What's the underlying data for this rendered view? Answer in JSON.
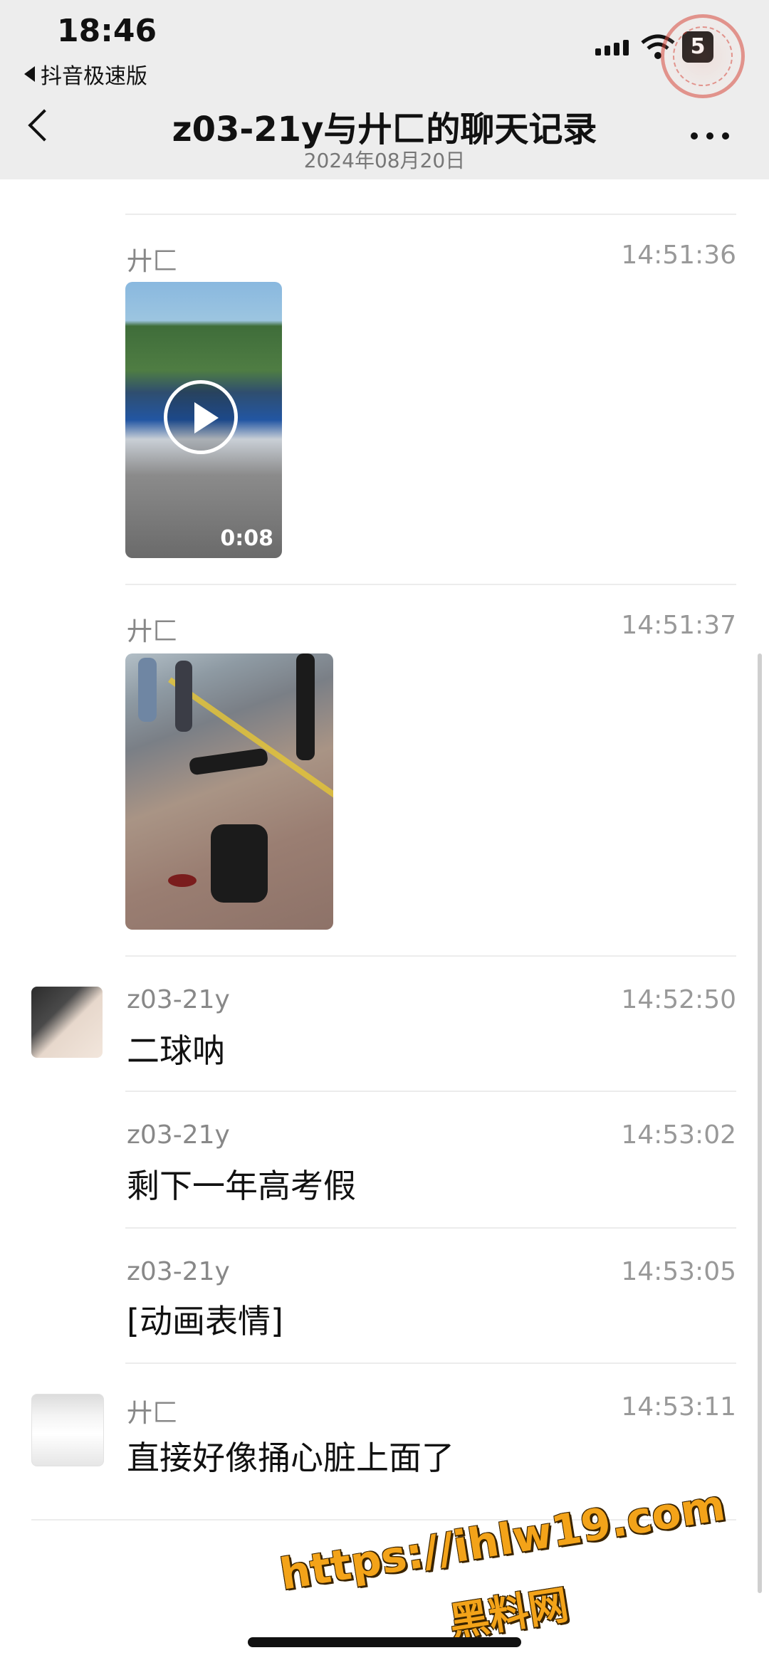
{
  "status_bar": {
    "time": "18:46",
    "back_app": "抖音极速版",
    "battery": "5"
  },
  "nav": {
    "title": "z03-21y与廾匚的聊天记录",
    "subtitle": "2024年08月20日"
  },
  "messages": [
    {
      "sender": "廾匚",
      "time": "14:51:36",
      "type": "video",
      "duration": "0:08"
    },
    {
      "sender": "廾匚",
      "time": "14:51:37",
      "type": "image"
    },
    {
      "sender": "z03-21y",
      "time": "14:52:50",
      "type": "text",
      "text": "二球呐"
    },
    {
      "sender": "z03-21y",
      "time": "14:53:02",
      "type": "text",
      "text": "剩下一年高考假"
    },
    {
      "sender": "z03-21y",
      "time": "14:53:05",
      "type": "text",
      "text": "[动画表情]"
    },
    {
      "sender": "廾匚",
      "time": "14:53:11",
      "type": "text",
      "text": "直接好像捅心脏上面了"
    }
  ],
  "watermark": {
    "url": "https://ihlw19.com",
    "name": "黑料网"
  },
  "colors": {
    "header_bg": "#ededed",
    "watermark": "#f3a319"
  }
}
